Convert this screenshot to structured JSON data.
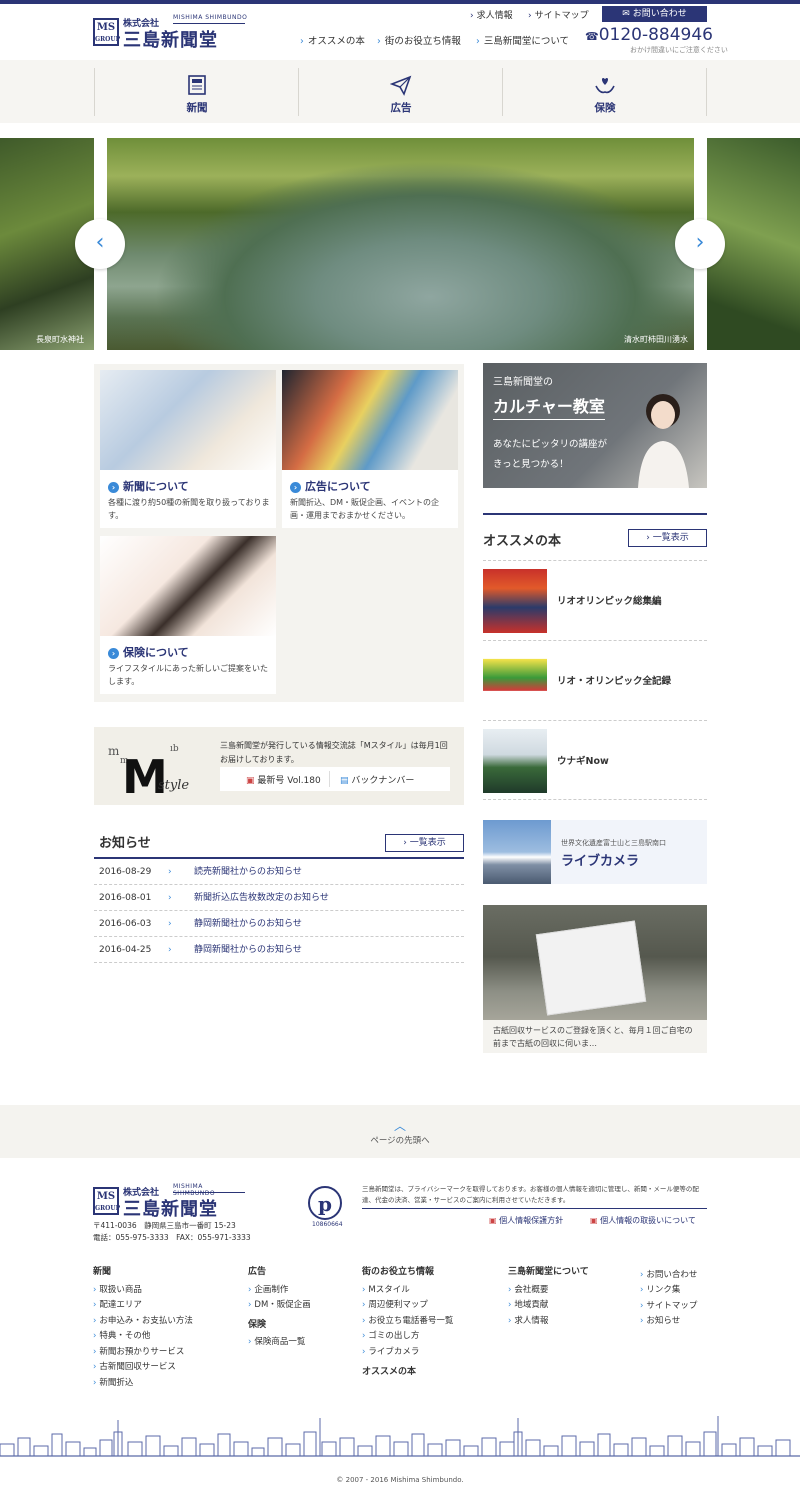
{
  "header": {
    "logo_small": "株式会社",
    "logo_sub": "MISHIMA SHIMBUNDO",
    "logo_big": "三島新聞堂",
    "logo_ms": "MS GROUP",
    "util_links": [
      "求人情報",
      "サイトマップ"
    ],
    "contact_label": "お問い合わせ",
    "gnav": [
      "オススメの本",
      "街のお役立ち情報",
      "三島新聞堂について"
    ],
    "tel": "0120-884946",
    "tel_note": "おかけ間違いにご注意ください"
  },
  "categories": [
    {
      "label": "新聞",
      "icon": "newspaper-icon"
    },
    {
      "label": "広告",
      "icon": "paper-plane-icon"
    },
    {
      "label": "保険",
      "icon": "hands-heart-icon"
    }
  ],
  "slider": {
    "left_caption": "長泉町水神社",
    "main_caption": "清水町柿田川湧水",
    "prev_label": "‹",
    "next_label": "›"
  },
  "services": [
    {
      "title": "新聞について",
      "desc": "各種に渡り約50種の新聞を取り扱っております。"
    },
    {
      "title": "広告について",
      "desc": "新聞折込、DM・販促企画、イベントの企画・運用までおまかせください。"
    },
    {
      "title": "保険について",
      "desc": "ライフスタイルにあった新しいご提案をいたします。"
    }
  ],
  "mstyle": {
    "text": "三島新聞堂が発行している情報交流誌「Mスタイル」は毎月1回お届けしております。",
    "latest": "最新号 Vol.180",
    "backnumber": "バックナンバー"
  },
  "news": {
    "heading": "お知らせ",
    "list_button": "一覧表示",
    "items": [
      {
        "date": "2016-08-29",
        "title": "読売新聞社からのお知らせ"
      },
      {
        "date": "2016-08-01",
        "title": "新聞折込広告枚数改定のお知らせ"
      },
      {
        "date": "2016-06-03",
        "title": "静岡新聞社からのお知らせ"
      },
      {
        "date": "2016-04-25",
        "title": "静岡新聞社からのお知らせ"
      }
    ]
  },
  "culture": {
    "line1": "三島新聞堂の",
    "line2": "カルチャー教室",
    "line3": "あなたにピッタリの講座が",
    "line4": "きっと見つかる！"
  },
  "books": {
    "heading": "オススメの本",
    "list_button": "一覧表示",
    "items": [
      {
        "name": "リオオリンピック総集編"
      },
      {
        "name": "リオ・オリンピック全記録"
      },
      {
        "name": "ウナギNow"
      }
    ]
  },
  "livecam": {
    "line1": "世界文化遺産富士山と三島駅南口",
    "line2": "ライブカメラ"
  },
  "paper_service": {
    "desc": "古紙回収サービスのご登録を頂くと、毎月１回ご自宅の前まで古紙の回収に伺いま…"
  },
  "pagetop": {
    "label": "ページの先頭へ"
  },
  "footer": {
    "address": "〒411-0036　静岡県三島市一番町 15-23",
    "phone": "電話：055-975-3333　FAX：055-971-3333",
    "privacy_note": "三島新聞堂は、プライバシーマークを取得しております。お客様の個人情報を適切に管理し、新聞・メール便等の配達、代金の決済、営業・サービスのご案内に利用させていただきます。",
    "privacy_links": [
      "個人情報保護方針",
      "個人情報の取扱いについて"
    ],
    "pmark_number": "10860664",
    "columns": [
      {
        "head": "新聞",
        "items": [
          "取扱い商品",
          "配達エリア",
          "お申込み・お支払い方法",
          "特典・その他",
          "新聞お預かりサービス",
          "古新聞回収サービス",
          "新聞折込"
        ]
      },
      {
        "head": "広告",
        "items": [
          "企画制作",
          "DM・販促企画"
        ]
      },
      {
        "head": "保険",
        "items": [
          "保険商品一覧"
        ]
      },
      {
        "head": "街のお役立ち情報",
        "items": [
          "Mスタイル",
          "周辺便利マップ",
          "お役立ち電話番号一覧",
          "ゴミの出し方",
          "ライブカメラ"
        ]
      },
      {
        "head": "オススメの本",
        "items": []
      },
      {
        "head": "三島新聞堂について",
        "items": [
          "会社概要",
          "地域貢献",
          "求人情報"
        ]
      },
      {
        "head": "",
        "items": [
          "お問い合わせ",
          "リンク集",
          "サイトマップ",
          "お知らせ"
        ]
      }
    ],
    "copyright": "© 2007 - 2016 Mishima Shimbundo."
  },
  "colors": {
    "navy": "#2b3576",
    "accent": "#3a8ad8",
    "band": "#f4f3ef"
  }
}
